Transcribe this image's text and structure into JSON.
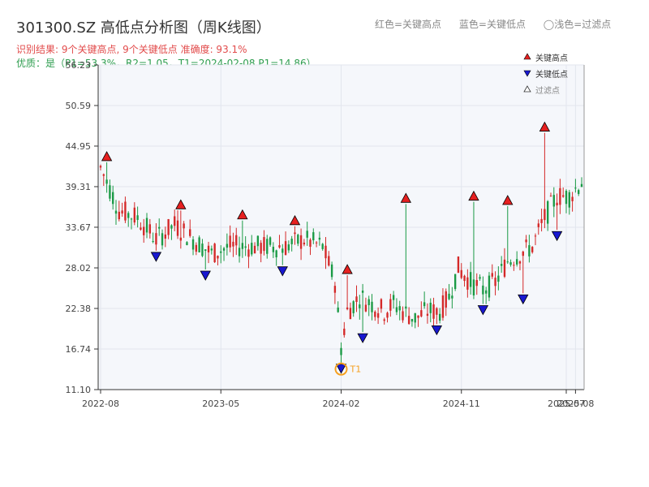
{
  "title": "301300.SZ 高低点分析图（周K线图）",
  "top_legend": {
    "red": "红色=关键高点",
    "blue": "蓝色=关键低点",
    "light": "◯浅色=过滤点"
  },
  "info_line1": "识别结果: 9个关键高点, 9个关键低点  准确度: 93.1%",
  "info_line2": "优质：是（P1=53.3%，R2=1.05，T1=2024-02-08 P1=14.86）",
  "colors": {
    "up": "#d42828",
    "down": "#1a9a45",
    "high": "#e62020",
    "low": "#1818d0",
    "t1": "#f5a020",
    "plot_bg": "#f5f7fb",
    "grid": "#e2e6ee",
    "axis": "#333333"
  },
  "chart_data": {
    "type": "candlestick",
    "y_ticks": [
      "11.10",
      "16.74",
      "22.38",
      "28.02",
      "33.67",
      "39.31",
      "44.95",
      "50.59",
      "56.23"
    ],
    "x_ticks": [
      {
        "label": "2022-08",
        "i": 0
      },
      {
        "label": "2023-05",
        "i": 39
      },
      {
        "label": "2024-02",
        "i": 78
      },
      {
        "label": "2024-11",
        "i": 117
      },
      {
        "label": "2025-07",
        "i": 151
      },
      {
        "label": "2025-08",
        "i": 154
      }
    ],
    "ylim": [
      11.1,
      56.23
    ],
    "num_bars": 157,
    "legend": {
      "high": "关键高点",
      "low": "关键低点",
      "filtered": "过滤点"
    },
    "t1_label": "T1",
    "anchors": [
      [
        0,
        42
      ],
      [
        6,
        36
      ],
      [
        12,
        35
      ],
      [
        18,
        32
      ],
      [
        24,
        34
      ],
      [
        30,
        32
      ],
      [
        36,
        30
      ],
      [
        42,
        31
      ],
      [
        48,
        31
      ],
      [
        54,
        31
      ],
      [
        60,
        31
      ],
      [
        66,
        32
      ],
      [
        72,
        31
      ],
      [
        76,
        26
      ],
      [
        78,
        17
      ],
      [
        80,
        22
      ],
      [
        84,
        24
      ],
      [
        88,
        23
      ],
      [
        92,
        22
      ],
      [
        95,
        23
      ],
      [
        98,
        22
      ],
      [
        102,
        21
      ],
      [
        106,
        22
      ],
      [
        110,
        22
      ],
      [
        113,
        24
      ],
      [
        116,
        28
      ],
      [
        120,
        26
      ],
      [
        124,
        25
      ],
      [
        128,
        26
      ],
      [
        132,
        29
      ],
      [
        136,
        30
      ],
      [
        140,
        31
      ],
      [
        144,
        35
      ],
      [
        148,
        38
      ],
      [
        152,
        38
      ],
      [
        156,
        40
      ]
    ],
    "key_highs": [
      {
        "i": 2,
        "v": 42.7
      },
      {
        "i": 26,
        "v": 36.0
      },
      {
        "i": 46,
        "v": 34.6
      },
      {
        "i": 63,
        "v": 33.8
      },
      {
        "i": 80,
        "v": 27.0
      },
      {
        "i": 99,
        "v": 36.9
      },
      {
        "i": 121,
        "v": 37.2
      },
      {
        "i": 132,
        "v": 36.6
      },
      {
        "i": 144,
        "v": 46.8
      }
    ],
    "key_lows": [
      {
        "i": 18,
        "v": 30.4
      },
      {
        "i": 34,
        "v": 27.8
      },
      {
        "i": 59,
        "v": 28.4
      },
      {
        "i": 78,
        "v": 14.86
      },
      {
        "i": 85,
        "v": 19.1
      },
      {
        "i": 109,
        "v": 20.2
      },
      {
        "i": 124,
        "v": 23.0
      },
      {
        "i": 137,
        "v": 24.5
      },
      {
        "i": 148,
        "v": 33.3
      }
    ]
  }
}
